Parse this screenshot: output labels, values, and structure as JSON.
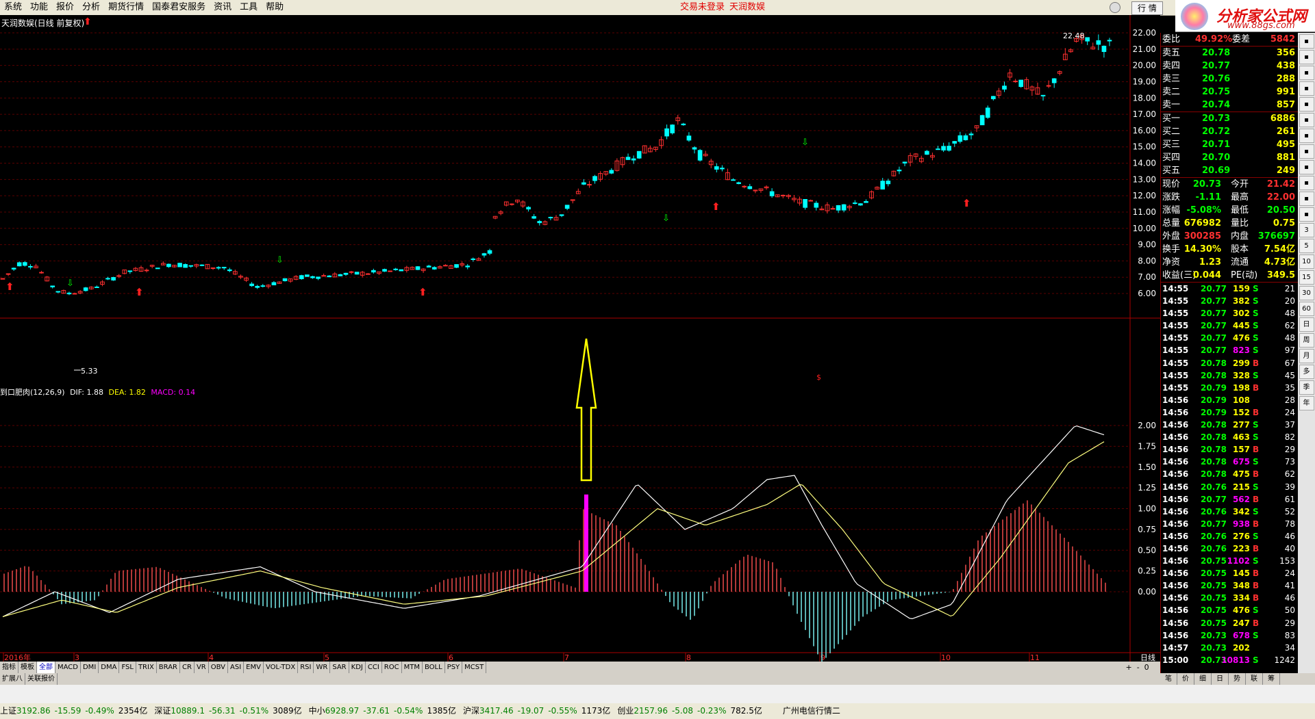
{
  "menu": [
    "系统",
    "功能",
    "报价",
    "分析",
    "期货行情",
    "国泰君安服务",
    "资讯",
    "工具",
    "帮助"
  ],
  "trade_status": [
    "交易未登录",
    "天润数娱"
  ],
  "quote_button": "行 情",
  "brand": {
    "name": "分析家公式网",
    "url": "www.88gs.com"
  },
  "chart_header": "天润数娱(日线 前复权)",
  "price_labels": {
    "high": "22.48",
    "low": "5.33"
  },
  "macd_header": {
    "name": "到口肥肉(12,26,9)",
    "dif": "DIF: 1.88",
    "dea": "DEA: 1.82",
    "macd": "MACD: 0.14"
  },
  "price_axis": [
    "22.00",
    "21.00",
    "20.00",
    "19.00",
    "18.00",
    "17.00",
    "16.00",
    "15.00",
    "14.00",
    "13.00",
    "12.00",
    "11.00",
    "10.00",
    "9.00",
    "8.00",
    "7.00",
    "6.00"
  ],
  "macd_axis": [
    "2.00",
    "1.75",
    "1.50",
    "1.25",
    "1.00",
    "0.75",
    "0.50",
    "0.25",
    "0.00"
  ],
  "x_axis": [
    "2016年",
    "3",
    "4",
    "5",
    "6",
    "7",
    "8",
    "9",
    "10",
    "11"
  ],
  "period_label": "日线",
  "tabs": [
    "指标",
    "模板",
    "全部",
    "MACD",
    "DMI",
    "DMA",
    "FSL",
    "TRIX",
    "BRAR",
    "CR",
    "VR",
    "OBV",
    "ASI",
    "EMV",
    "VOL-TDX",
    "RSI",
    "WR",
    "SAR",
    "KDJ",
    "CCI",
    "ROC",
    "MTM",
    "BOLL",
    "PSY",
    "MCST"
  ],
  "active_tab": "全部",
  "tabs2": [
    "扩展八",
    "关联报价"
  ],
  "order_book": {
    "ratio": {
      "label": "委比",
      "value": "49.92%",
      "label2": "委差",
      "value2": "5842"
    },
    "asks": [
      {
        "label": "卖五",
        "price": "20.78",
        "vol": "356"
      },
      {
        "label": "卖四",
        "price": "20.77",
        "vol": "438"
      },
      {
        "label": "卖三",
        "price": "20.76",
        "vol": "288"
      },
      {
        "label": "卖二",
        "price": "20.75",
        "vol": "991"
      },
      {
        "label": "卖一",
        "price": "20.74",
        "vol": "857"
      }
    ],
    "bids": [
      {
        "label": "买一",
        "price": "20.73",
        "vol": "6886"
      },
      {
        "label": "买二",
        "price": "20.72",
        "vol": "261"
      },
      {
        "label": "买三",
        "price": "20.71",
        "vol": "495"
      },
      {
        "label": "买四",
        "price": "20.70",
        "vol": "881"
      },
      {
        "label": "买五",
        "price": "20.69",
        "vol": "249"
      }
    ]
  },
  "quote_stats": [
    {
      "l1": "现价",
      "v1": "20.73",
      "c1": "#00ff00",
      "l2": "今开",
      "v2": "21.42",
      "c2": "#ff3030"
    },
    {
      "l1": "涨跌",
      "v1": "-1.11",
      "c1": "#00ff00",
      "l2": "最高",
      "v2": "22.00",
      "c2": "#ff3030"
    },
    {
      "l1": "涨幅",
      "v1": "-5.08%",
      "c1": "#00ff00",
      "l2": "最低",
      "v2": "20.50",
      "c2": "#00ff00"
    },
    {
      "l1": "总量",
      "v1": "676982",
      "c1": "#ffff00",
      "l2": "量比",
      "v2": "0.75",
      "c2": "#ffff00"
    },
    {
      "l1": "外盘",
      "v1": "300285",
      "c1": "#ff3030",
      "l2": "内盘",
      "v2": "376697",
      "c2": "#00ff00"
    },
    {
      "l1": "换手",
      "v1": "14.30%",
      "c1": "#ffff00",
      "l2": "股本",
      "v2": "7.54亿",
      "c2": "#ffff00"
    },
    {
      "l1": "净资",
      "v1": "1.23",
      "c1": "#ffff00",
      "l2": "流通",
      "v2": "4.73亿",
      "c2": "#ffff00"
    },
    {
      "l1": "收益(三)",
      "v1": "0.044",
      "c1": "#ffff00",
      "l2": "PE(动)",
      "v2": "349.5",
      "c2": "#ffff00"
    }
  ],
  "ticks": [
    [
      "14:55",
      "20.77",
      "159",
      "S",
      "21"
    ],
    [
      "14:55",
      "20.77",
      "382",
      "S",
      "20"
    ],
    [
      "14:55",
      "20.77",
      "302",
      "S",
      "48"
    ],
    [
      "14:55",
      "20.77",
      "445",
      "S",
      "62"
    ],
    [
      "14:55",
      "20.77",
      "476",
      "S",
      "48"
    ],
    [
      "14:55",
      "20.77",
      "823",
      "S",
      "97"
    ],
    [
      "14:55",
      "20.78",
      "299",
      "B",
      "67"
    ],
    [
      "14:55",
      "20.78",
      "328",
      "S",
      "45"
    ],
    [
      "14:55",
      "20.79",
      "198",
      "B",
      "35"
    ],
    [
      "14:56",
      "20.79",
      "108",
      "",
      "28"
    ],
    [
      "14:56",
      "20.79",
      "152",
      "B",
      "24"
    ],
    [
      "14:56",
      "20.78",
      "277",
      "S",
      "37"
    ],
    [
      "14:56",
      "20.78",
      "463",
      "S",
      "82"
    ],
    [
      "14:56",
      "20.78",
      "157",
      "B",
      "29"
    ],
    [
      "14:56",
      "20.78",
      "675",
      "S",
      "73"
    ],
    [
      "14:56",
      "20.78",
      "475",
      "B",
      "62"
    ],
    [
      "14:56",
      "20.76",
      "215",
      "S",
      "39"
    ],
    [
      "14:56",
      "20.77",
      "562",
      "B",
      "61"
    ],
    [
      "14:56",
      "20.76",
      "342",
      "S",
      "52"
    ],
    [
      "14:56",
      "20.77",
      "938",
      "B",
      "78"
    ],
    [
      "14:56",
      "20.76",
      "276",
      "S",
      "46"
    ],
    [
      "14:56",
      "20.76",
      "223",
      "B",
      "40"
    ],
    [
      "14:56",
      "20.75",
      "1102",
      "S",
      "153"
    ],
    [
      "14:56",
      "20.75",
      "145",
      "B",
      "24"
    ],
    [
      "14:56",
      "20.75",
      "348",
      "B",
      "41"
    ],
    [
      "14:56",
      "20.75",
      "334",
      "B",
      "46"
    ],
    [
      "14:56",
      "20.75",
      "476",
      "S",
      "50"
    ],
    [
      "14:56",
      "20.75",
      "247",
      "B",
      "29"
    ],
    [
      "14:56",
      "20.73",
      "678",
      "S",
      "83"
    ],
    [
      "14:57",
      "20.73",
      "202",
      "",
      "34"
    ],
    [
      "15:00",
      "20.73",
      "10813",
      "S",
      "1242"
    ]
  ],
  "right_toolbar": [
    "3",
    "5",
    "10",
    "15",
    "30",
    "60",
    "日",
    "周",
    "月",
    "多",
    "季",
    "年"
  ],
  "bottom_nav": [
    "笔",
    "价",
    "细",
    "日",
    "势",
    "联",
    "筹"
  ],
  "status_bar": [
    {
      "name": "上证",
      "val": "3192.86",
      "chg": "-15.59",
      "pct": "-0.49%",
      "amt": "2354亿"
    },
    {
      "name": "深证",
      "val": "10889.1",
      "chg": "-56.31",
      "pct": "-0.51%",
      "amt": "3089亿"
    },
    {
      "name": "中小",
      "val": "6928.97",
      "chg": "-37.61",
      "pct": "-0.54%",
      "amt": "1385亿"
    },
    {
      "name": "沪深",
      "val": "3417.46",
      "chg": "-19.07",
      "pct": "-0.55%",
      "amt": "1173亿"
    },
    {
      "name": "创业",
      "val": "2157.96",
      "chg": "-5.08",
      "pct": "-0.23%",
      "amt": "782.5亿"
    }
  ],
  "status_right": "广州电信行情二",
  "colors": {
    "up": "#ff3030",
    "down": "#00ffff",
    "dif": "#ffffff",
    "dea": "#ffff80",
    "annot_arrow": "#ffff00",
    "annot_bar": "#ff00ff"
  }
}
